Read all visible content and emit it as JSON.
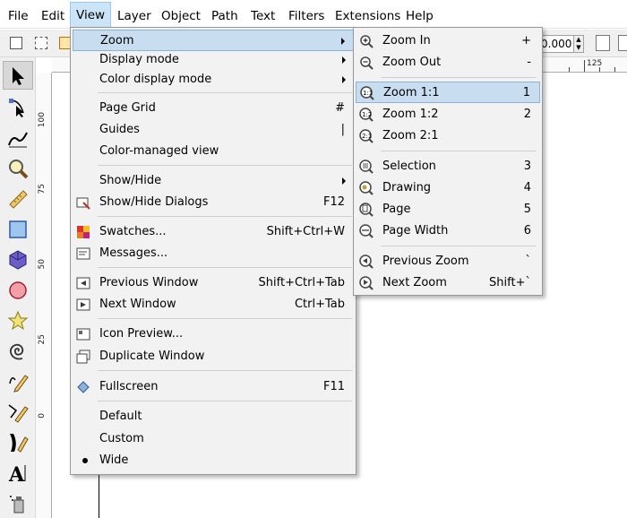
{
  "menubar": {
    "items": [
      "File",
      "Edit",
      "View",
      "Layer",
      "Object",
      "Path",
      "Text",
      "Filters",
      "Extensions",
      "Help"
    ],
    "active": "View"
  },
  "toolbar": {
    "spin_value": "0.000"
  },
  "ruler": {
    "top_label": "125",
    "left_labels": [
      "100",
      "75",
      "50",
      "25",
      "0"
    ]
  },
  "toolbox": {
    "tools": [
      "selector-tool",
      "node-tool",
      "tweak-tool",
      "zoom-tool",
      "measure-tool",
      "rectangle-tool",
      "3dbox-tool",
      "ellipse-tool",
      "star-tool",
      "spiral-tool",
      "pencil-tool",
      "pen-tool",
      "calligraphy-tool",
      "text-tool",
      "spray-tool"
    ]
  },
  "view_menu": {
    "items": [
      {
        "label": "Zoom",
        "shortcut": "",
        "submenu": true,
        "icon": ""
      },
      {
        "label": "Display mode",
        "shortcut": "",
        "submenu": true,
        "icon": ""
      },
      {
        "label": "Color display mode",
        "shortcut": "",
        "submenu": true,
        "icon": ""
      },
      {
        "label": "Page Grid",
        "shortcut": "#",
        "submenu": false,
        "icon": ""
      },
      {
        "label": "Guides",
        "shortcut": "|",
        "submenu": false,
        "icon": ""
      },
      {
        "label": "Color-managed view",
        "shortcut": "",
        "submenu": false,
        "icon": ""
      },
      {
        "label": "Show/Hide",
        "shortcut": "",
        "submenu": true,
        "icon": ""
      },
      {
        "label": "Show/Hide Dialogs",
        "shortcut": "F12",
        "submenu": false,
        "icon": "dialogs-icon"
      },
      {
        "label": "Swatches...",
        "shortcut": "Shift+Ctrl+W",
        "submenu": false,
        "icon": "swatches-icon"
      },
      {
        "label": "Messages...",
        "shortcut": "",
        "submenu": false,
        "icon": "messages-icon"
      },
      {
        "label": "Previous Window",
        "shortcut": "Shift+Ctrl+Tab",
        "submenu": false,
        "icon": "previous-window-icon"
      },
      {
        "label": "Next Window",
        "shortcut": "Ctrl+Tab",
        "submenu": false,
        "icon": "next-window-icon"
      },
      {
        "label": "Icon Preview...",
        "shortcut": "",
        "submenu": false,
        "icon": "icon-preview-icon"
      },
      {
        "label": "Duplicate Window",
        "shortcut": "",
        "submenu": false,
        "icon": "duplicate-window-icon"
      },
      {
        "label": "Fullscreen",
        "shortcut": "F11",
        "submenu": false,
        "icon": "fullscreen-icon"
      },
      {
        "label": "Default",
        "shortcut": "",
        "submenu": false,
        "icon": ""
      },
      {
        "label": "Custom",
        "shortcut": "",
        "submenu": false,
        "icon": ""
      },
      {
        "label": "Wide",
        "shortcut": "",
        "submenu": false,
        "icon": "radio-dot"
      }
    ]
  },
  "zoom_menu": {
    "items": [
      {
        "label": "Zoom In",
        "shortcut": "+",
        "icon": "zoom-in-icon"
      },
      {
        "label": "Zoom Out",
        "shortcut": "-",
        "icon": "zoom-out-icon"
      },
      {
        "label": "Zoom 1:1",
        "shortcut": "1",
        "icon": "zoom-1-1-icon"
      },
      {
        "label": "Zoom 1:2",
        "shortcut": "2",
        "icon": "zoom-1-2-icon"
      },
      {
        "label": "Zoom 2:1",
        "shortcut": "",
        "icon": "zoom-2-1-icon"
      },
      {
        "label": "Selection",
        "shortcut": "3",
        "icon": "zoom-selection-icon"
      },
      {
        "label": "Drawing",
        "shortcut": "4",
        "icon": "zoom-drawing-icon"
      },
      {
        "label": "Page",
        "shortcut": "5",
        "icon": "zoom-page-icon"
      },
      {
        "label": "Page Width",
        "shortcut": "6",
        "icon": "zoom-page-width-icon"
      },
      {
        "label": "Previous Zoom",
        "shortcut": "`",
        "icon": "zoom-previous-icon"
      },
      {
        "label": "Next Zoom",
        "shortcut": "Shift+`",
        "icon": "zoom-next-icon"
      }
    ],
    "highlighted": "Zoom 1:1"
  },
  "colors": {
    "menu_highlight": "#c8ddf0",
    "menu_bg": "#f2f2f2",
    "menubar_active": "#cce4f7"
  }
}
